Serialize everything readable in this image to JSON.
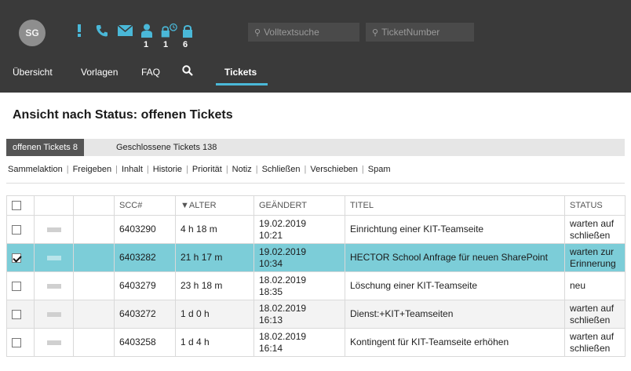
{
  "header": {
    "avatar_initials": "SG",
    "icons": [
      {
        "name": "exclamation-icon",
        "badge": ""
      },
      {
        "name": "phone-icon",
        "badge": ""
      },
      {
        "name": "envelope-icon",
        "badge": ""
      },
      {
        "name": "user-icon",
        "badge": "1"
      },
      {
        "name": "lock-clock-icon",
        "badge": "1"
      },
      {
        "name": "lock-icon",
        "badge": "6"
      }
    ],
    "fulltext_search_placeholder": "Volltextsuche",
    "ticket_number_placeholder": "TicketNumber",
    "accent_color": "#4ab8d8"
  },
  "nav": {
    "overview": "Übersicht",
    "templates": "Vorlagen",
    "faq": "FAQ",
    "search_icon": "search-icon",
    "tickets": "Tickets"
  },
  "page": {
    "title": "Ansicht nach Status: offenen Tickets"
  },
  "tabs": {
    "open": "offenen Tickets 8",
    "closed": "Geschlossene Tickets 138"
  },
  "actions": [
    "Sammelaktion",
    "Freigeben",
    "Inhalt",
    "Historie",
    "Priorität",
    "Notiz",
    "Schließen",
    "Verschieben",
    "Spam"
  ],
  "table": {
    "columns": {
      "scc": "SCC#",
      "age": "▼ALTER",
      "changed": "GEÄNDERT",
      "title": "TITEL",
      "status": "STATUS"
    },
    "rows": [
      {
        "checked": false,
        "scc": "6403290",
        "age": "4 h 18 m",
        "changed_date": "19.02.2019",
        "changed_time": "10:21",
        "title": "Einrichtung einer KIT-Teamseite",
        "status": "warten auf schließen"
      },
      {
        "checked": true,
        "scc": "6403282",
        "age": "21 h 17 m",
        "changed_date": "19.02.2019",
        "changed_time": "10:34",
        "title": "HECTOR School Anfrage für neuen SharePoint",
        "status": "warten zur Erinnerung"
      },
      {
        "checked": false,
        "scc": "6403279",
        "age": "23 h 18 m",
        "changed_date": "18.02.2019",
        "changed_time": "18:35",
        "title": "Löschung einer KIT-Teamseite",
        "status": "neu"
      },
      {
        "checked": false,
        "scc": "6403272",
        "age": "1 d 0 h",
        "changed_date": "18.02.2019",
        "changed_time": "16:13",
        "title": "Dienst:+KIT+Teamseiten",
        "status": "warten auf schließen"
      },
      {
        "checked": false,
        "scc": "6403258",
        "age": "1 d 4 h",
        "changed_date": "18.02.2019",
        "changed_time": "16:14",
        "title": "Kontingent für KIT-Teamseite erhöhen",
        "status": "warten auf schließen"
      }
    ]
  }
}
